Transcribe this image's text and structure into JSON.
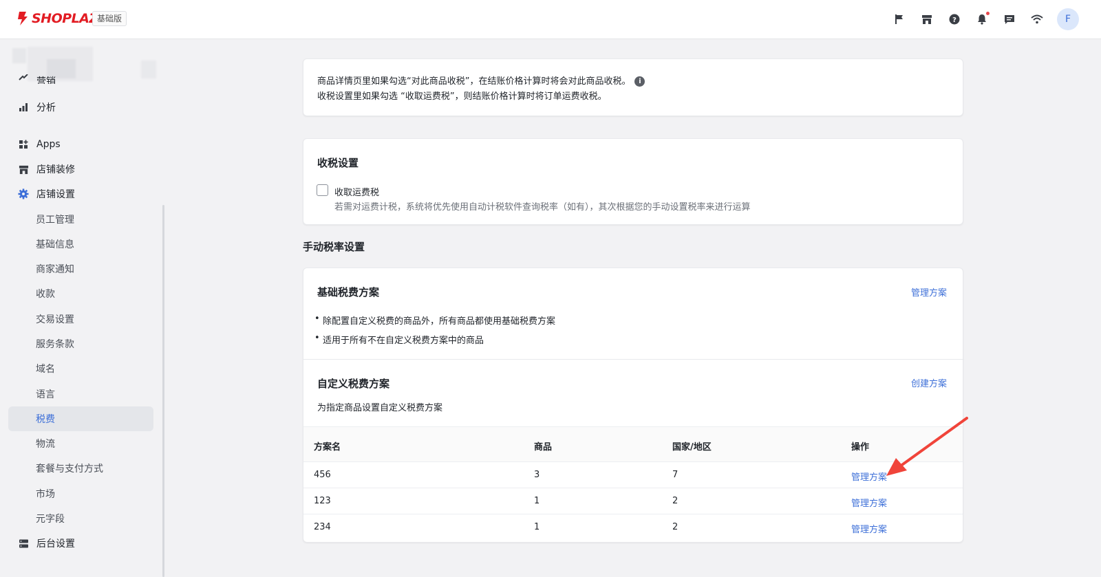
{
  "topbar": {
    "brand": "SHOPLAZZA",
    "plan_badge": "基础版",
    "icons": [
      "flag-icon",
      "store-icon",
      "help-icon",
      "bell-icon",
      "message-icon",
      "wifi-icon"
    ],
    "avatar_letter": "F",
    "brand_color": "#e21c23"
  },
  "sidebar": {
    "partial_item": "营销",
    "items": [
      {
        "label": "分析",
        "icon": "bar-chart-icon"
      },
      {
        "label": "Apps",
        "icon": "apps-icon"
      },
      {
        "label": "店铺装修",
        "icon": "store-icon"
      },
      {
        "label": "店铺设置",
        "icon": "gear-icon"
      }
    ],
    "sub_items": [
      "员工管理",
      "基础信息",
      "商家通知",
      "收款",
      "交易设置",
      "服务条款",
      "域名",
      "语言",
      "税费",
      "物流",
      "套餐与支付方式",
      "市场",
      "元字段"
    ],
    "active_sub_item": "税费",
    "bottom_item": {
      "label": "后台设置",
      "icon": "server-icon"
    },
    "accent_color": "#3d6fd8"
  },
  "notice": {
    "line1": "商品详情页里如果勾选“对此商品收税”，在结账价格计算时将会对此商品收税。",
    "line2": "收税设置里如果勾选 “收取运费税”，则结账价格计算时将订单运费收税。",
    "info_glyph": "i"
  },
  "tax_settings": {
    "title": "收税设置",
    "checkbox_label": "收取运费税",
    "checkbox_checked": false,
    "checkbox_help": "若需对运费计税，系统将优先使用自动计税软件查询税率（如有），其次根据您的手动设置税率来进行运算"
  },
  "manual_rates": {
    "heading": "手动税率设置",
    "base": {
      "title": "基础税费方案",
      "link": "管理方案",
      "bullets": [
        "除配置自定义税费的商品外，所有商品都使用基础税费方案",
        "适用于所有不在自定义税费方案中的商品"
      ]
    },
    "custom": {
      "title": "自定义税费方案",
      "link": "创建方案",
      "description": "为指定商品设置自定义税费方案",
      "columns": [
        "方案名",
        "商品",
        "国家/地区",
        "操作"
      ],
      "rows": [
        {
          "name": "456",
          "products": "3",
          "regions": "7",
          "action": "管理方案"
        },
        {
          "name": "123",
          "products": "1",
          "regions": "2",
          "action": "管理方案"
        },
        {
          "name": "234",
          "products": "1",
          "regions": "2",
          "action": "管理方案"
        }
      ]
    }
  },
  "annotation": {
    "arrow_color": "#f0443a"
  }
}
